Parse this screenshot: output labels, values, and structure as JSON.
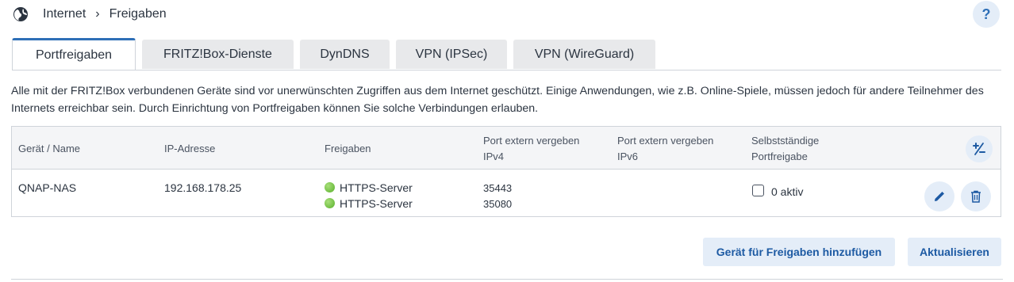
{
  "breadcrumb": {
    "root": "Internet",
    "separator": "›",
    "current": "Freigaben"
  },
  "help": {
    "label": "?"
  },
  "tabs": [
    {
      "label": "Portfreigaben",
      "active": true
    },
    {
      "label": "FRITZ!Box-Dienste",
      "active": false
    },
    {
      "label": "DynDNS",
      "active": false
    },
    {
      "label": "VPN (IPSec)",
      "active": false
    },
    {
      "label": "VPN (WireGuard)",
      "active": false
    }
  ],
  "intro": "Alle mit der FRITZ!Box verbundenen Geräte sind vor unerwünschten Zugriffen aus dem Internet geschützt. Einige Anwendungen, wie z.B. Online-Spiele, müssen jedoch für andere Teilnehmer des Internets erreichbar sein. Durch Einrichtung von Portfreigaben können Sie solche Verbindungen erlauben.",
  "table": {
    "headers": {
      "device": "Gerät / Name",
      "ip": "IP-Adresse",
      "shares": "Freigaben",
      "ipv4_1": "Port extern vergeben",
      "ipv4_2": "IPv4",
      "ipv6_1": "Port extern vergeben",
      "ipv6_2": "IPv6",
      "self_1": "Selbstständige",
      "self_2": "Portfreigabe"
    },
    "row": {
      "device": "QNAP-NAS",
      "ip": "192.168.178.25",
      "shares": [
        "HTTPS-Server",
        "HTTPS-Server"
      ],
      "ports_ipv4": [
        "35443",
        "35080"
      ],
      "self_share": "0 aktiv",
      "self_share_checked": false
    }
  },
  "buttons": {
    "add_device": "Gerät für Freigaben hinzufügen",
    "refresh": "Aktualisieren"
  },
  "colors": {
    "accent": "#2e6fb7",
    "button_bg": "#e4edf8",
    "status_ok": "#58b02b"
  }
}
